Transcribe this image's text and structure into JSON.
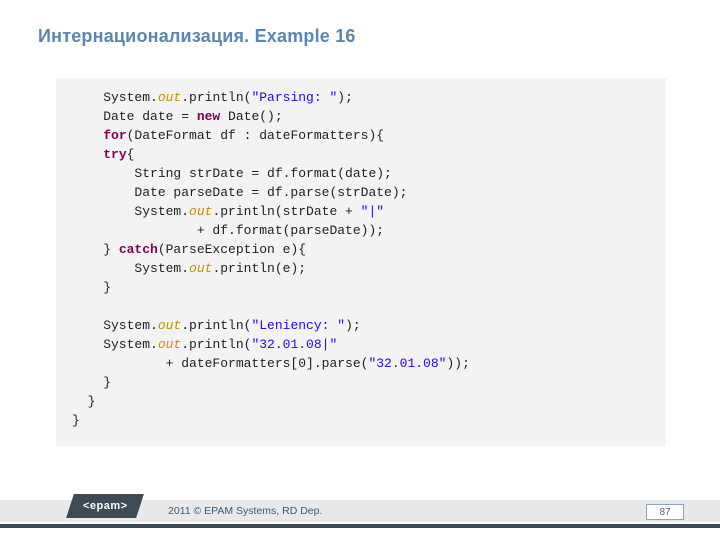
{
  "title": "Интернационализация. Example 16",
  "code": {
    "l1a": "    System.",
    "l1b": "out",
    "l1c": ".println(",
    "l1d": "\"Parsing: \"",
    "l1e": ");",
    "l2a": "    Date date = ",
    "l2b": "new",
    "l2c": " Date();",
    "l3a": "    ",
    "l3b": "for",
    "l3c": "(DateFormat df : dateFormatters){",
    "l4a": "    ",
    "l4b": "try",
    "l4c": "{",
    "l5": "        String strDate = df.format(date);",
    "l6": "        Date parseDate = df.parse(strDate);",
    "l7a": "        System.",
    "l7b": "out",
    "l7c": ".println(strDate + ",
    "l7d": "\"|\"",
    "l8": "                + df.format(parseDate));",
    "l9a": "    } ",
    "l9b": "catch",
    "l9c": "(ParseException e){",
    "l10a": "        System.",
    "l10b": "out",
    "l10c": ".println(e);",
    "l11": "    }",
    "blank": "",
    "l12a": "    System.",
    "l12b": "out",
    "l12c": ".println(",
    "l12d": "\"Leniency: \"",
    "l12e": ");",
    "l13a": "    System.",
    "l13b": "out",
    "l13c": ".println(",
    "l13d": "\"32.01.08|\"",
    "l14a": "            + dateFormatters[0].parse(",
    "l14b": "\"32.01.08\"",
    "l14c": "));",
    "l15": "    }",
    "l16": "  }",
    "l17": "}"
  },
  "footer": {
    "logo": "<epam>",
    "copyright": "2011 © EPAM Systems, RD Dep.",
    "page": "87"
  }
}
